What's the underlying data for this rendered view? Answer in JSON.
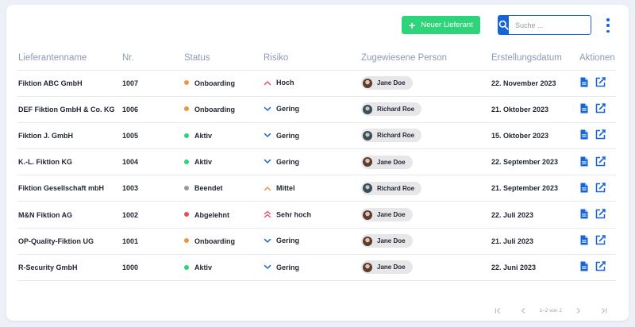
{
  "toolbar": {
    "new_supplier_label": "Neuer Lieferant",
    "search_placeholder": "Suche ...",
    "accent": "#2ed47a",
    "primary": "#1565d8"
  },
  "table": {
    "headers": {
      "name": "Lieferantenname",
      "nr": "Nr.",
      "status": "Status",
      "risk": "Risiko",
      "person": "Zugewiesene Person",
      "created": "Erstellungsdatum",
      "actions": "Aktionen"
    },
    "rows": [
      {
        "name": "Fiktion ABC GmbH",
        "nr": "1007",
        "status": "Onboarding",
        "status_color": "#f0963a",
        "risk": "Hoch",
        "risk_icon": "chevron-up-icon",
        "risk_color": "#e0526a",
        "person": "Jane Doe",
        "avatar": "jane",
        "created": "22. November 2023"
      },
      {
        "name": "DEF Fiktion GmbH & Co. KG",
        "nr": "1006",
        "status": "Onboarding",
        "status_color": "#f0963a",
        "risk": "Gering",
        "risk_icon": "chevron-down-icon",
        "risk_color": "#1565d8",
        "person": "Richard Roe",
        "avatar": "richard",
        "created": "21. Oktober 2023"
      },
      {
        "name": "Fiktion J. GmbH",
        "nr": "1005",
        "status": "Aktiv",
        "status_color": "#2ed47a",
        "risk": "Gering",
        "risk_icon": "chevron-down-icon",
        "risk_color": "#1565d8",
        "person": "Richard Roe",
        "avatar": "richard",
        "created": "15. Oktober 2023"
      },
      {
        "name": "K.-L. Fiktion KG",
        "nr": "1004",
        "status": "Aktiv",
        "status_color": "#2ed47a",
        "risk": "Gering",
        "risk_icon": "chevron-down-icon",
        "risk_color": "#1565d8",
        "person": "Jane Doe",
        "avatar": "jane",
        "created": "22. September 2023"
      },
      {
        "name": "Fiktion Gesellschaft mbH",
        "nr": "1003",
        "status": "Beendet",
        "status_color": "#9a9a9a",
        "risk": "Mittel",
        "risk_icon": "chevron-up-icon",
        "risk_color": "#f0963a",
        "person": "Richard Roe",
        "avatar": "richard",
        "created": "21. September 2023"
      },
      {
        "name": "M&N Fiktion AG",
        "nr": "1002",
        "status": "Abgelehnt",
        "status_color": "#ea4a5a",
        "risk": "Sehr hoch",
        "risk_icon": "double-chevron-up-icon",
        "risk_color": "#e0526a",
        "person": "Jane Doe",
        "avatar": "jane",
        "created": "22. Juli 2023"
      },
      {
        "name": "OP-Quality-Fiktion UG",
        "nr": "1001",
        "status": "Onboarding",
        "status_color": "#f0963a",
        "risk": "Gering",
        "risk_icon": "chevron-down-icon",
        "risk_color": "#1565d8",
        "person": "Jane Doe",
        "avatar": "jane",
        "created": "21. Juli 2023"
      },
      {
        "name": "R-Security GmbH",
        "nr": "1000",
        "status": "Aktiv",
        "status_color": "#2ed47a",
        "risk": "Gering",
        "risk_icon": "chevron-down-icon",
        "risk_color": "#1565d8",
        "person": "Jane Doe",
        "avatar": "jane",
        "created": "22. Juni 2023"
      }
    ]
  },
  "pagination": {
    "info": "1–2 von 2"
  }
}
